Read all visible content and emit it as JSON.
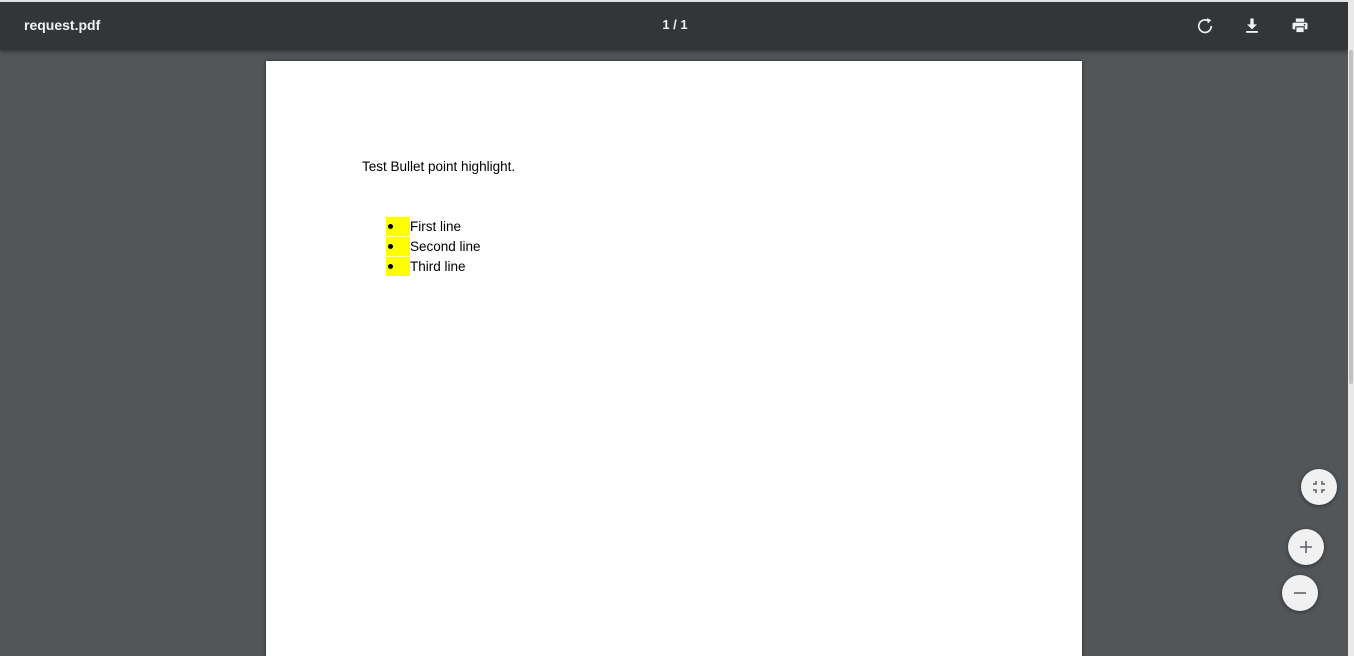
{
  "toolbar": {
    "title": "request.pdf",
    "page_indicator": "1 / 1",
    "background": "#323639",
    "icons": {
      "rotate": "rotate-icon",
      "download": "download-icon",
      "print": "print-icon"
    }
  },
  "document": {
    "heading": "Test Bullet point highlight.",
    "highlight_color": "#ffff00",
    "bullets": [
      {
        "text": "First line"
      },
      {
        "text": "Second line"
      },
      {
        "text": "Third line"
      }
    ]
  },
  "zoom_controls": {
    "icons": {
      "fit": "fit-to-page-icon",
      "zoom_in": "plus-icon",
      "zoom_out": "minus-icon"
    }
  }
}
